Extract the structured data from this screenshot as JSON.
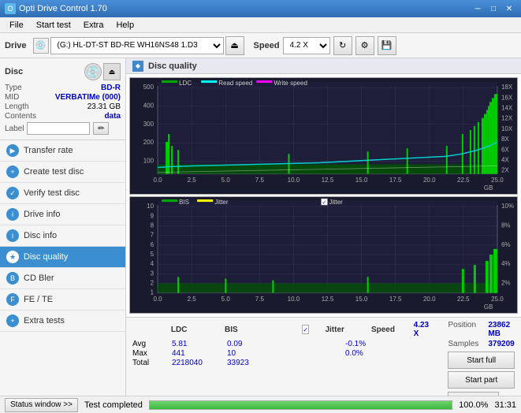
{
  "titleBar": {
    "title": "Opti Drive Control 1.70",
    "minimizeBtn": "─",
    "maximizeBtn": "□",
    "closeBtn": "✕"
  },
  "menuBar": {
    "items": [
      "File",
      "Start test",
      "Extra",
      "Help"
    ]
  },
  "toolbar": {
    "driveLabel": "Drive",
    "driveValue": "(G:) HL-DT-ST BD-RE  WH16NS48 1.D3",
    "speedLabel": "Speed",
    "speedValue": "4.2 X"
  },
  "disc": {
    "title": "Disc",
    "typeLabel": "Type",
    "typeValue": "BD-R",
    "midLabel": "MID",
    "midValue": "VERBATIMe (000)",
    "lengthLabel": "Length",
    "lengthValue": "23.31 GB",
    "contentsLabel": "Contents",
    "contentsValue": "data",
    "labelLabel": "Label"
  },
  "navItems": [
    {
      "id": "transfer-rate",
      "label": "Transfer rate",
      "active": false
    },
    {
      "id": "create-test-disc",
      "label": "Create test disc",
      "active": false
    },
    {
      "id": "verify-test-disc",
      "label": "Verify test disc",
      "active": false
    },
    {
      "id": "drive-info",
      "label": "Drive info",
      "active": false
    },
    {
      "id": "disc-info",
      "label": "Disc info",
      "active": false
    },
    {
      "id": "disc-quality",
      "label": "Disc quality",
      "active": true
    },
    {
      "id": "cd-bler",
      "label": "CD Bler",
      "active": false
    },
    {
      "id": "fe-te",
      "label": "FE / TE",
      "active": false
    },
    {
      "id": "extra-tests",
      "label": "Extra tests",
      "active": false
    }
  ],
  "chartTitle": "Disc quality",
  "legend1": {
    "ldc": "LDC",
    "readSpeed": "Read speed",
    "writeSpeed": "Write speed"
  },
  "legend2": {
    "bis": "BIS",
    "jitter": "Jitter"
  },
  "chart1": {
    "yLabels": [
      "500",
      "400",
      "300",
      "200",
      "100"
    ],
    "yLabelsRight": [
      "18X",
      "16X",
      "14X",
      "12X",
      "10X",
      "8X",
      "6X",
      "4X",
      "2X"
    ],
    "xLabels": [
      "0.0",
      "2.5",
      "5.0",
      "7.5",
      "10.0",
      "12.5",
      "15.0",
      "17.5",
      "20.0",
      "22.5",
      "25.0"
    ],
    "xUnit": "GB"
  },
  "chart2": {
    "yLabels": [
      "10",
      "9",
      "8",
      "7",
      "6",
      "5",
      "4",
      "3",
      "2",
      "1"
    ],
    "yLabelsRight": [
      "10%",
      "8%",
      "6%",
      "4%",
      "2%"
    ],
    "xLabels": [
      "0.0",
      "2.5",
      "5.0",
      "7.5",
      "10.0",
      "12.5",
      "15.0",
      "17.5",
      "20.0",
      "22.5",
      "25.0"
    ],
    "xUnit": "GB"
  },
  "stats": {
    "columns": [
      "",
      "LDC",
      "BIS",
      "",
      "Jitter",
      "Speed",
      "4.23 X"
    ],
    "rows": [
      {
        "label": "Avg",
        "ldc": "5.81",
        "bis": "0.09",
        "jitter": "-0.1%"
      },
      {
        "label": "Max",
        "ldc": "441",
        "bis": "10",
        "jitter": "0.0%"
      },
      {
        "label": "Total",
        "ldc": "2218040",
        "bis": "33923",
        "jitter": ""
      }
    ],
    "position": "23862 MB",
    "samples": "379209",
    "speedDisplay": "4.2 X",
    "startFull": "Start full",
    "startPart": "Start part"
  },
  "statusBar": {
    "windowBtn": "Status window >>",
    "progress": 100,
    "progressText": "100.0%",
    "statusText": "Test completed",
    "time": "31:31"
  }
}
